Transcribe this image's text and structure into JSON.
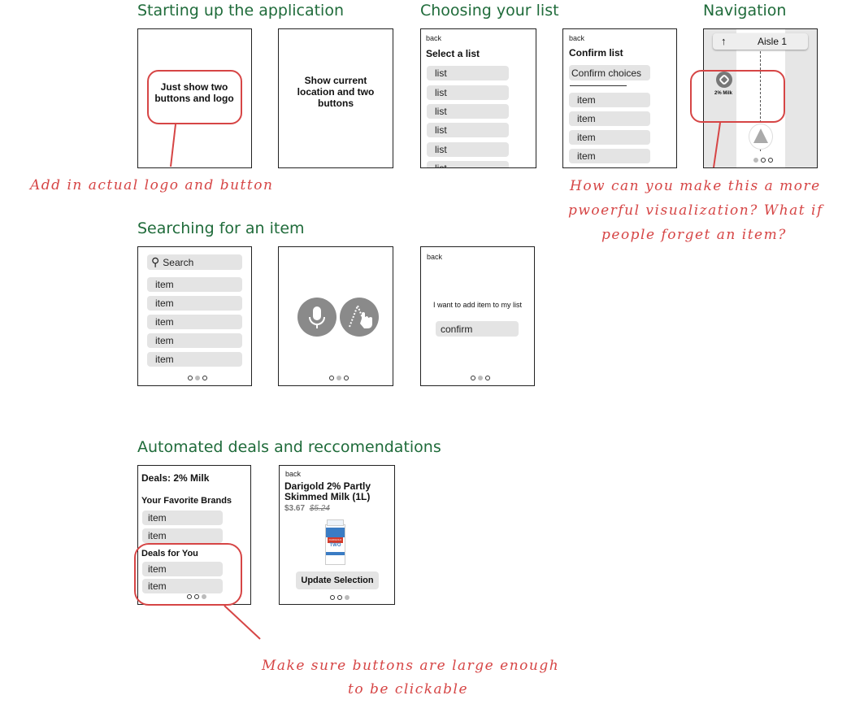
{
  "sections": {
    "startup": "Starting up the application",
    "choose": "Choosing your list",
    "nav": "Navigation",
    "search": "Searching for an item",
    "deals": "Automated deals and reccomendations"
  },
  "startup": {
    "frame1_text": "Just show two buttons and logo",
    "frame2_text": "Show current location and two buttons"
  },
  "select_list": {
    "back": "back",
    "title": "Select a list",
    "items": [
      "list",
      "list",
      "list",
      "list",
      "list",
      "list"
    ]
  },
  "confirm_list": {
    "back": "back",
    "title": "Confirm list",
    "confirm": "Confirm choices",
    "items": [
      "item",
      "item",
      "item",
      "item"
    ]
  },
  "navigation": {
    "arrow": "↑",
    "aisle": "Aisle 1",
    "marker_label": "2% Milk"
  },
  "search": {
    "placeholder": "Search",
    "items": [
      "item",
      "item",
      "item",
      "item",
      "item"
    ],
    "add_back": "back",
    "add_text": "I want to add item to my list",
    "add_confirm": "confirm"
  },
  "deals": {
    "title": "Deals: 2% Milk",
    "fav_header": "Your Favorite Brands",
    "fav_items": [
      "item",
      "item"
    ],
    "deals_header": "Deals for You",
    "deal_items": [
      "item",
      "item"
    ]
  },
  "product": {
    "back": "back",
    "name": "Darigold 2% Partly Skimmed Milk (1L)",
    "price": "$3.67",
    "old_price": "$5.24",
    "carton_brand": "DARIGOLD",
    "carton_label": "TWO",
    "button": "Update Selection"
  },
  "notes": {
    "logo": "Add in actual logo and button",
    "nav_line1": "How can you make this a more",
    "nav_line2": "pwoerful visualization? What if",
    "nav_line3": "people forget an item?",
    "buttons_line1": "Make sure buttons are large enough",
    "buttons_line2": "to be clickable"
  },
  "colors": {
    "heading": "#1f6b3a",
    "annotation": "#d64545",
    "pill": "#e4e4e4"
  }
}
